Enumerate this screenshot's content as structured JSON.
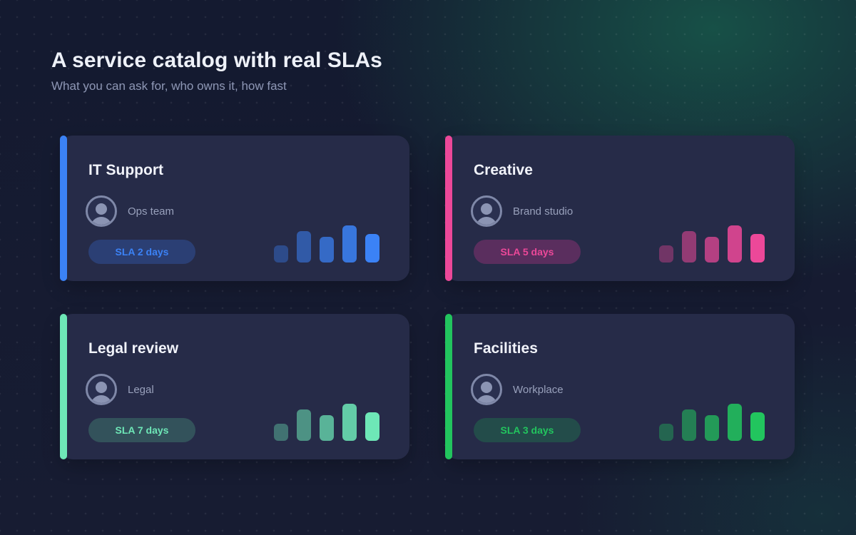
{
  "header": {
    "title": "A service catalog with real SLAs",
    "subtitle": "What you can ask for, who owns it, how fast"
  },
  "services": [
    {
      "title": "IT Support",
      "owner": "Ops team",
      "sla": "SLA 2 days",
      "accent": "#3b82f6",
      "badge_bg": "#2b3f74",
      "badge_text": "#3b82f6",
      "avatar_icon": "person-icon",
      "trend": [
        0.4,
        0.73,
        0.6,
        0.87,
        0.67
      ]
    },
    {
      "title": "Creative",
      "owner": "Brand studio",
      "sla": "SLA 5 days",
      "accent": "#ec4899",
      "badge_bg": "#5a2e5e",
      "badge_text": "#ec4899",
      "avatar_icon": "person-icon",
      "trend": [
        0.4,
        0.73,
        0.6,
        0.87,
        0.67
      ]
    },
    {
      "title": "Legal review",
      "owner": "Legal",
      "sla": "SLA 7 days",
      "accent": "#6ee7b7",
      "badge_bg": "#33525b",
      "badge_text": "#6ee7b7",
      "avatar_icon": "person-icon",
      "trend": [
        0.4,
        0.73,
        0.6,
        0.87,
        0.67
      ]
    },
    {
      "title": "Facilities",
      "owner": "Workplace",
      "sla": "SLA 3 days",
      "accent": "#22c55e",
      "badge_bg": "#234c4a",
      "badge_text": "#22c55e",
      "avatar_icon": "person-icon",
      "trend": [
        0.4,
        0.73,
        0.6,
        0.87,
        0.67
      ]
    }
  ]
}
